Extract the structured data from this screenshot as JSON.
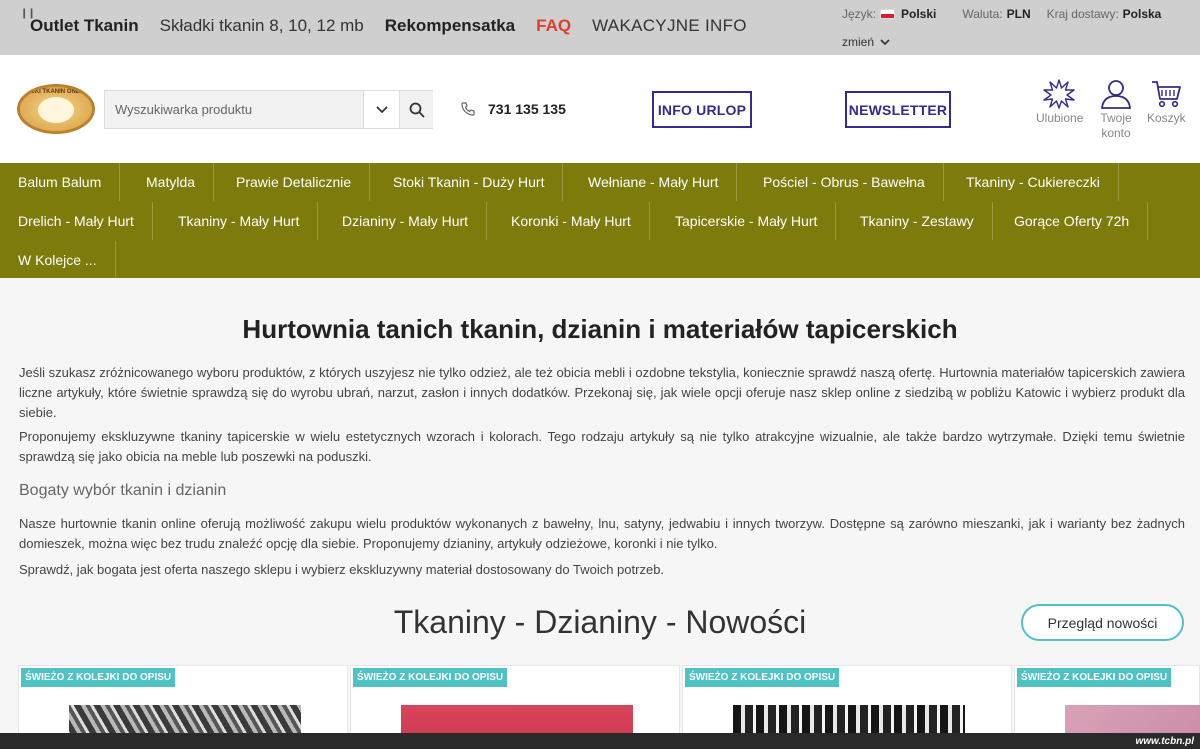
{
  "topbar": {
    "links": [
      "Outlet Tkanin",
      "Składki tkanin 8, 10, 12 mb",
      "Rekompensatka",
      "FAQ",
      "WAKACYJNE INFO"
    ],
    "language_label": "Język:",
    "language_value": "Polski",
    "currency_label": "Waluta:",
    "currency_value": "PLN",
    "country_label": "Kraj dostawy:",
    "country_value": "Polska",
    "change_label": "zmień"
  },
  "header": {
    "logo_text": "STOKI TKANIN ONLINE",
    "search_placeholder": "Wyszukiwarka produktu",
    "phone": "731 135 135",
    "info_urlop": "INFO URLOP",
    "newsletter": "NEWSLETTER",
    "favorites_label": "Ulubione",
    "account_label_1": "Twoje",
    "account_label_2": "konto",
    "cart_label": "Koszyk"
  },
  "nav": {
    "items": [
      "Balum Balum",
      "Matylda",
      "Prawie Detalicznie",
      "Stoki Tkanin - Duży Hurt",
      "Wełniane - Mały Hurt",
      "Pościel - Obrus - Bawełna",
      "Tkaniny - Cukiereczki",
      "Drelich - Mały Hurt",
      "Tkaniny - Mały Hurt",
      "Dzianiny - Mały Hurt",
      "Koronki - Mały Hurt",
      "Tapicerskie - Mały Hurt",
      "Tkaniny - Zestawy",
      "Gorące Oferty 72h",
      "W Kolejce ..."
    ]
  },
  "main": {
    "title": "Hurtownia tanich tkanin, dzianin i materiałów tapicerskich",
    "p1": "Jeśli szukasz zróżnicowanego wyboru produktów, z których uszyjesz nie tylko odzież, ale też obicia mebli i ozdobne tekstylia, koniecznie sprawdź naszą ofertę. Hurtownia materiałów tapicerskich zawiera liczne artykuły, które świetnie sprawdzą się do wyrobu ubrań, narzut, zasłon i innych dodatków. Przekonaj się, jak wiele opcji oferuje nasz sklep online z siedzibą w pobliżu Katowic i wybierz produkt dla siebie.",
    "p2": "Proponujemy ekskluzywne tkaniny tapicerskie w wielu estetycznych wzorach i kolorach. Tego rodzaju artykuły są nie tylko atrakcyjne wizualnie, ale także bardzo wytrzymałe. Dzięki temu świetnie sprawdzą się jako obicia na meble lub poszewki na poduszki.",
    "subheading": "Bogaty wybór tkanin i dzianin",
    "p3": "Nasze hurtownie tkanin online oferują możliwość zakupu wielu produktów wykonanych z bawełny, lnu, satyny, jedwabiu i innych tworzyw. Dostępne są zarówno mieszanki, jak i warianty bez żadnych domieszek, można więc bez trudu znaleźć opcję dla siebie. Proponujemy dzianiny, artykuły odzieżowe, koronki i nie tylko.",
    "p4": "Sprawdź, jak bogata jest oferta naszego sklepu i wybierz ekskluzywny materiał dostosowany do Twoich potrzeb.",
    "section_title": "Tkaniny - Dzianiny - Nowości",
    "review_button": "Przegląd nowości",
    "badge": "ŚWIEŻO Z KOLEJKI DO OPISU"
  },
  "watermark": "www.tcbn.pl",
  "colors": {
    "nav_bg": "#7d7b0c",
    "accent_purple": "#3b2790",
    "badge_teal": "#4fc2c6",
    "faq_red": "#e23c2b"
  }
}
